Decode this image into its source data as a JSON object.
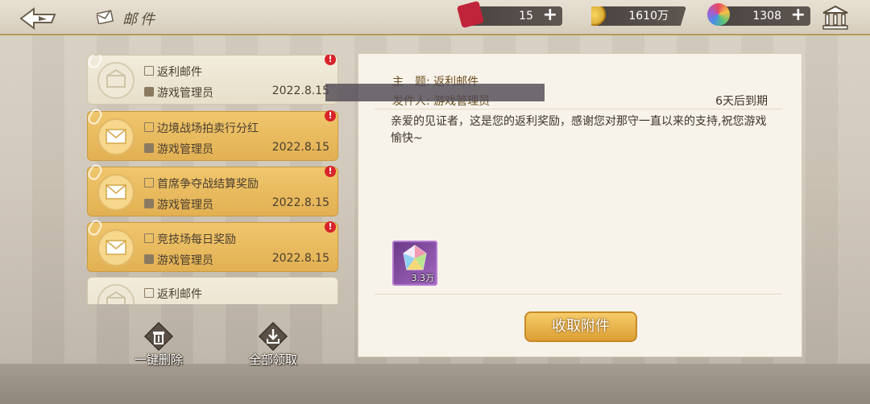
{
  "header": {
    "title": "邮件",
    "resources": [
      {
        "name": "ticket",
        "icon": "ticket-icon",
        "value": "15",
        "color": "#c0243a"
      },
      {
        "name": "gold",
        "icon": "gold-coin-icon",
        "value": "1610万",
        "color": "#e1b335"
      },
      {
        "name": "gem",
        "icon": "rainbow-gem-icon",
        "value": "1308",
        "color": "#9b6ad0"
      }
    ]
  },
  "mail_list": [
    {
      "subject": "返利邮件",
      "sender": "游戏管理员",
      "date": "2022.8.15",
      "state": "read"
    },
    {
      "subject": "边境战场拍卖行分红",
      "sender": "游戏管理员",
      "date": "2022.8.15",
      "state": "unread"
    },
    {
      "subject": "首席争夺战结算奖励",
      "sender": "游戏管理员",
      "date": "2022.8.15",
      "state": "unread"
    },
    {
      "subject": "竞技场每日奖励",
      "sender": "游戏管理员",
      "date": "2022.8.15",
      "state": "unread"
    },
    {
      "subject": "返利邮件",
      "sender": "",
      "date": "",
      "state": "read"
    }
  ],
  "actions": {
    "delete_all": "一键删除",
    "claim_all": "全部领取"
  },
  "detail": {
    "subject_label": "主　题:",
    "subject": "返利邮件",
    "sender_label": "发件人:",
    "sender": "游戏管理员",
    "expiry": "6天后到期",
    "body": "亲爱的见证者，这是您的返利奖励，感谢您对那守一直以来的支持,祝您游戏愉快~",
    "attachment": {
      "icon": "rainbow-gem-icon",
      "count": "3.3万"
    },
    "collect_button": "收取附件"
  }
}
